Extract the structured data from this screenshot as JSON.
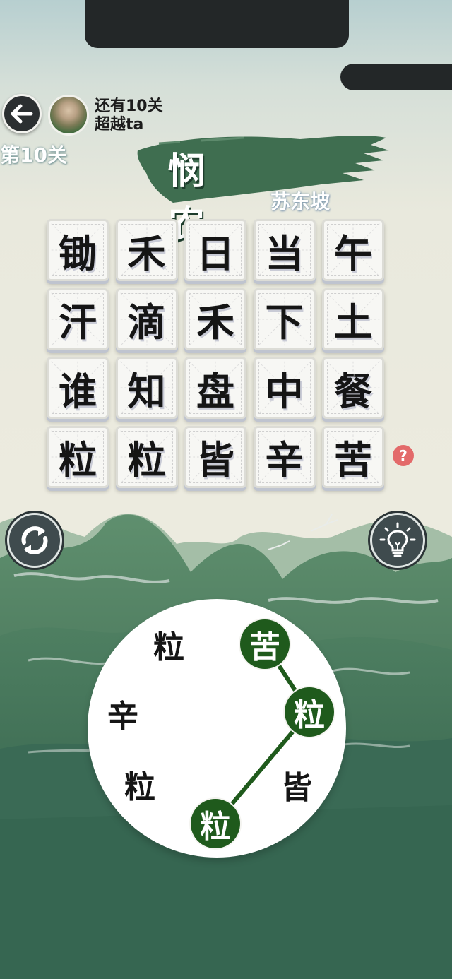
{
  "header": {
    "surpass_line1": "还有10关",
    "surpass_line2": "超越ta",
    "level": "第10关"
  },
  "poem": {
    "title": "悯 农",
    "author": "苏东坡"
  },
  "grid": [
    [
      "锄",
      "禾",
      "日",
      "当",
      "午"
    ],
    [
      "汗",
      "滴",
      "禾",
      "下",
      "土"
    ],
    [
      "谁",
      "知",
      "盘",
      "中",
      "餐"
    ],
    [
      "粒",
      "粒",
      "皆",
      "辛",
      "苦"
    ]
  ],
  "help_label": "?",
  "wheel": {
    "chars": [
      "粒",
      "苦",
      "粒",
      "皆",
      "粒",
      "粒",
      "辛"
    ],
    "selected": [
      1,
      2,
      4
    ]
  },
  "icons": {
    "back": "back-arrow-icon",
    "shuffle": "refresh-icon",
    "hint": "lightbulb-icon",
    "help": "question-icon"
  },
  "colors": {
    "selected_char": "#1f5a1c",
    "mountains": "#3e6b4f",
    "help": "#e36a6a"
  }
}
